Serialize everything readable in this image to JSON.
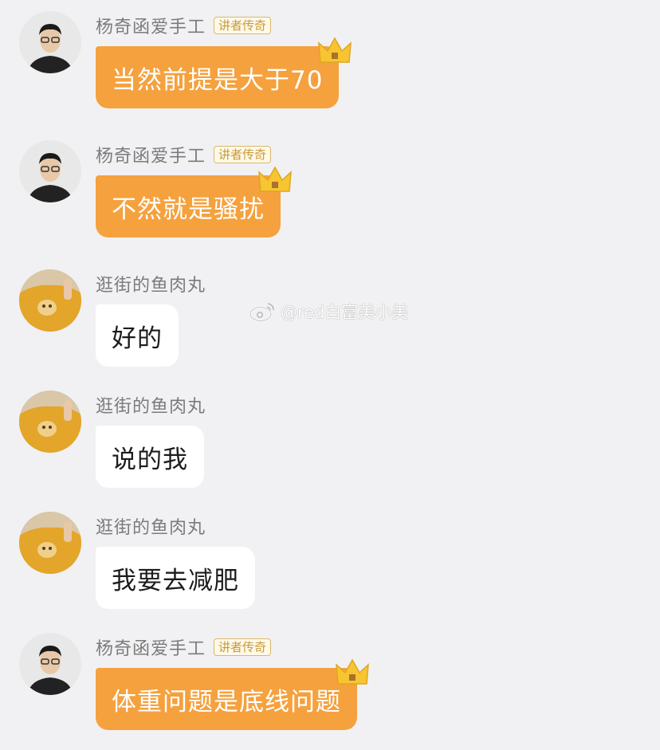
{
  "chat": {
    "messages": [
      {
        "sender": "杨奇函爱手工",
        "badge": "讲者传奇",
        "text": "当然前提是大于70",
        "style": "orange",
        "avatar": "man-glasses-avatar"
      },
      {
        "sender": "杨奇函爱手工",
        "badge": "讲者传奇",
        "text": "不然就是骚扰",
        "style": "orange",
        "avatar": "man-glasses-avatar"
      },
      {
        "sender": "逛街的鱼肉丸",
        "text": "好的",
        "style": "white",
        "avatar": "yellow-sweater-avatar"
      },
      {
        "sender": "逛街的鱼肉丸",
        "text": "说的我",
        "style": "white",
        "avatar": "yellow-sweater-avatar"
      },
      {
        "sender": "逛街的鱼肉丸",
        "text": "我要去减肥",
        "style": "white",
        "avatar": "yellow-sweater-avatar"
      },
      {
        "sender": "杨奇函爱手工",
        "badge": "讲者传奇",
        "text": "体重问题是底线问题",
        "style": "orange",
        "avatar": "man-glasses-avatar"
      }
    ]
  },
  "watermark": {
    "text": "@red白富美小美",
    "icon": "weibo-icon"
  },
  "colors": {
    "orange_bubble": "#f5a13e",
    "white_bubble": "#ffffff",
    "background": "#f1f1f3",
    "badge_border": "#d9b96a"
  }
}
